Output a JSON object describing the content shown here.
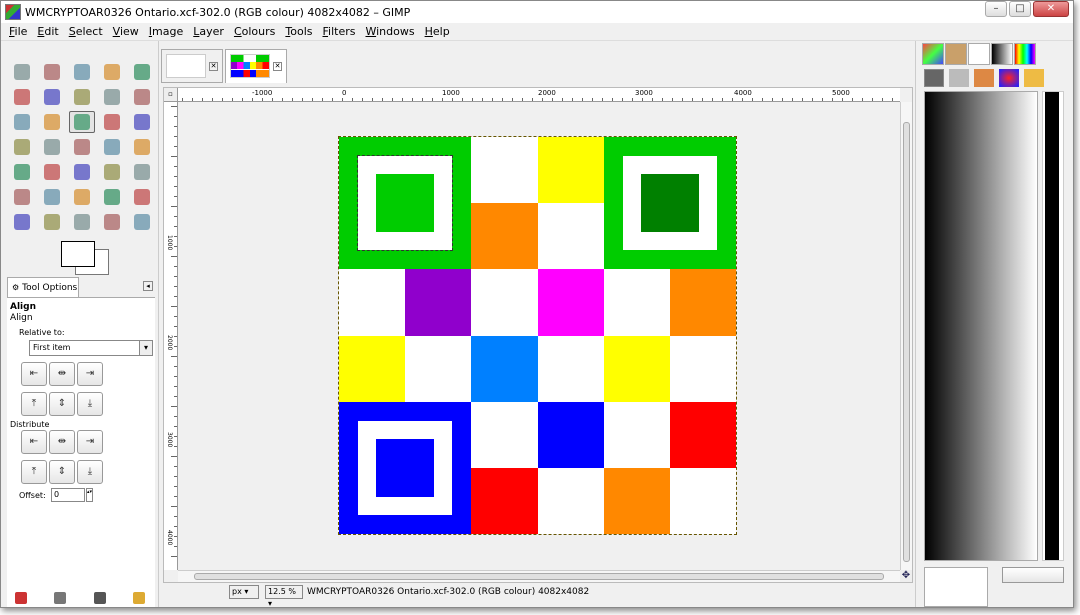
{
  "window": {
    "title": "WMCRYPTOAR0326 Ontario.xcf-302.0 (RGB colour) 4082x4082 – GIMP"
  },
  "menu": [
    "File",
    "Edit",
    "Select",
    "View",
    "Image",
    "Layer",
    "Colours",
    "Tools",
    "Filters",
    "Windows",
    "Help"
  ],
  "tools": [
    "rect-select",
    "ellipse-select",
    "free-select",
    "fuzzy-select",
    "by-color-select",
    "scissors-select",
    "foreground-select",
    "paths",
    "color-picker",
    "zoom",
    "measure",
    "move",
    "align",
    "crop",
    "rotate",
    "scale",
    "shear",
    "perspective",
    "flip",
    "cage-transform",
    "text",
    "bucket-fill",
    "blend",
    "pencil",
    "paintbrush",
    "eraser",
    "airbrush",
    "ink",
    "clone",
    "heal",
    "perspective-clone",
    "blur",
    "smudge",
    "dodge-burn",
    "extra"
  ],
  "tool_options": {
    "tab_label": "Tool Options",
    "title": "Align",
    "subtitle": "Align",
    "relative_to_label": "Relative to:",
    "relative_to_value": "First item",
    "distribute_label": "Distribute",
    "offset_label": "Offset:",
    "offset_value": "0"
  },
  "ruler": {
    "h_labels": [
      "-1000",
      "0",
      "1000",
      "2000",
      "3000",
      "4000",
      "5000"
    ],
    "v_labels": [
      "1000",
      "2000",
      "3000",
      "4000"
    ]
  },
  "status": {
    "unit": "px",
    "zoom": "12.5 %",
    "text": "WMCRYPTOAR0326 Ontario.xcf-302.0 (RGB colour) 4082x4082"
  },
  "colors": {
    "green": "#00cc00",
    "dark_green": "#008000",
    "yellow": "#ffff00",
    "orange": "#ff8800",
    "purple": "#9000cc",
    "magenta": "#ff00ff",
    "sky_blue": "#0080ff",
    "blue": "#0000ff",
    "red": "#ff0000",
    "white": "#ffffff"
  },
  "grid": [
    [
      "F",
      "F",
      "W",
      "Y",
      "F",
      "F"
    ],
    [
      "F",
      "F",
      "O",
      "W",
      "F",
      "F"
    ],
    [
      "W",
      "P",
      "W",
      "M",
      "W",
      "O"
    ],
    [
      "Y",
      "W",
      "S",
      "W",
      "Y",
      "W"
    ],
    [
      "F",
      "F",
      "W",
      "B",
      "W",
      "R"
    ],
    [
      "F",
      "F",
      "R",
      "W",
      "O",
      "W"
    ]
  ]
}
